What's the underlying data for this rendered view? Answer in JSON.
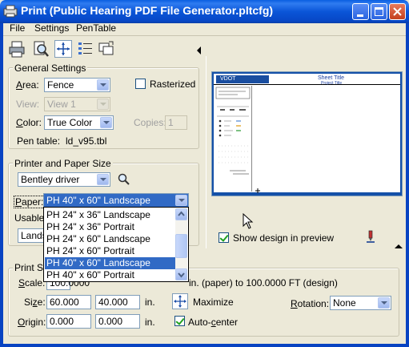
{
  "window": {
    "title": "Print  (Public Hearing PDF File Generator.pltcfg)",
    "minimize": "minimize",
    "maximize": "maximize",
    "close": "close"
  },
  "menu": {
    "file": "File",
    "settings": "Settings",
    "pentable": "PenTable"
  },
  "general": {
    "title": "General Settings",
    "area_label": "Area:",
    "area_value": "Fence",
    "rasterized_label": "Rasterized",
    "view_label": "View:",
    "view_value": "View 1",
    "color_label": "Color:",
    "color_value": "True Color",
    "copies_label": "Copies:",
    "copies_value": "1",
    "pentable_label": "Pen table:",
    "pentable_value": "ld_v95.tbl"
  },
  "printer": {
    "title": "Printer and Paper Size",
    "driver_value": "Bentley driver",
    "paper_label": "Paper:",
    "paper_value": "PH 40\" x 60\" Landscape",
    "usable_label": "Usable",
    "orient_partial": "Lands"
  },
  "dropdown": {
    "items": [
      "PH 24\" x 36\" Landscape",
      "PH 24\" x 36\" Portrait",
      "PH 24\" x 60\" Landscape",
      "PH 24\" x 60\" Portrait",
      "PH 40\" x 60\" Landscape",
      "PH 40\" x 60\" Portrait"
    ],
    "selected_index": 4
  },
  "preview": {
    "show_design_label": "Show design in preview",
    "sheet_title": "Sheet Title",
    "project_title": "Project Title",
    "logo_text": "VDOT"
  },
  "scale": {
    "title_partial": "Print Sc",
    "scale_label": "Scale:",
    "scale_value": "100.0000",
    "scale_desc": "in. (paper) to 100.0000 FT (design)",
    "size_label": "Size:",
    "size_w": "60.000",
    "size_h": "40.000",
    "size_unit": "in.",
    "maximize_label": "Maximize",
    "rotation_label": "Rotation:",
    "rotation_value": "None",
    "origin_label": "Origin:",
    "origin_x": "0.000",
    "origin_y": "0.000",
    "origin_unit": "in.",
    "autocenter_label": "Auto-center"
  }
}
